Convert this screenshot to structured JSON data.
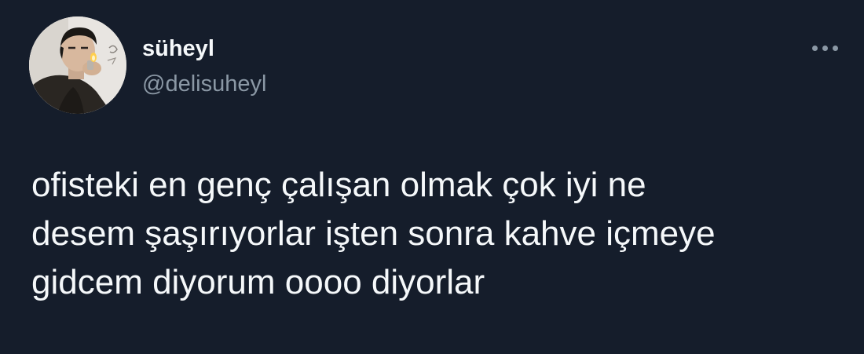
{
  "author": {
    "display_name": "süheyl",
    "handle": "@delisuheyl",
    "avatar_icon": "profile-photo"
  },
  "menu": {
    "icon": "more-horizontal-icon"
  },
  "tweet": {
    "lines": [
      "ofisteki en genç çalışan olmak çok iyi ne",
      "desem şaşırıyorlar işten sonra kahve içmeye",
      "gidcem diyorum oooo diyorlar"
    ]
  },
  "colors": {
    "background": "#151d2b",
    "text_primary": "#f5f8fa",
    "text_secondary": "#8b98a5"
  }
}
